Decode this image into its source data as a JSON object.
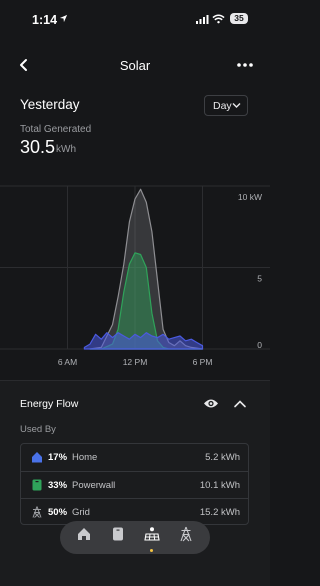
{
  "status_bar": {
    "time": "1:14",
    "battery": "35"
  },
  "nav": {
    "title": "Solar"
  },
  "period": {
    "title": "Yesterday",
    "selector_value": "Day"
  },
  "summary": {
    "label": "Total Generated",
    "value": "30.5",
    "unit": "kWh"
  },
  "chart_data": {
    "type": "area",
    "x_tick_labels": [
      "6 AM",
      "12 PM",
      "6 PM"
    ],
    "y_tick_labels": [
      "10 kW",
      "5",
      "0"
    ],
    "ylim": [
      0,
      10
    ],
    "xlim_hours": [
      0,
      24
    ],
    "grid": true,
    "series": [
      {
        "color": "#8e8e92",
        "x": [
          8.0,
          9.0,
          10.0,
          10.5,
          11.0,
          11.5,
          12.0,
          12.5,
          13.0,
          13.5,
          14.0,
          14.5,
          15.0,
          15.5,
          16.0,
          16.5,
          17.0,
          18.0
        ],
        "values": [
          0.0,
          0.1,
          1.5,
          3.2,
          5.2,
          7.8,
          9.2,
          9.8,
          9.0,
          7.2,
          4.2,
          1.2,
          0.4,
          0.2,
          0.5,
          0.2,
          0.1,
          0.0
        ]
      },
      {
        "color": "#2fa35a",
        "x": [
          8.0,
          9.0,
          10.0,
          10.5,
          11.0,
          11.5,
          12.0,
          12.5,
          13.0,
          13.5,
          14.0,
          14.5,
          15.0,
          15.5,
          16.0,
          18.0
        ],
        "values": [
          0.0,
          0.0,
          0.3,
          1.2,
          3.5,
          5.2,
          5.9,
          5.8,
          5.0,
          2.2,
          0.5,
          0.1,
          0.0,
          0.0,
          0.0,
          0.0
        ]
      },
      {
        "color": "#4a5ae0",
        "x": [
          7.5,
          8.0,
          8.5,
          9.0,
          9.5,
          10.0,
          10.5,
          11.0,
          11.5,
          12.0,
          12.5,
          13.0,
          13.5,
          14.0,
          14.5,
          15.0,
          15.5,
          16.0,
          16.5,
          17.0,
          17.5,
          18.0
        ],
        "values": [
          0.1,
          0.3,
          0.9,
          0.6,
          1.0,
          0.7,
          1.0,
          0.8,
          0.6,
          0.9,
          0.7,
          1.0,
          0.8,
          0.7,
          0.9,
          0.6,
          0.7,
          0.8,
          0.5,
          0.6,
          0.4,
          0.2
        ]
      }
    ]
  },
  "energy_flow": {
    "title": "Energy Flow",
    "used_by_label": "Used By",
    "rows": [
      {
        "icon": "home-icon",
        "color": "#4a72e8",
        "percent": "17%",
        "name": "Home",
        "value": "5.2 kWh"
      },
      {
        "icon": "powerwall-icon",
        "color": "#2fa35a",
        "percent": "33%",
        "name": "Powerwall",
        "value": "10.1 kWh"
      },
      {
        "icon": "grid-tower-icon",
        "color": "#9a9ca0",
        "percent": "50%",
        "name": "Grid",
        "value": "15.2 kWh"
      }
    ]
  },
  "tabbar": {
    "tabs": [
      "home-tab-icon",
      "powerwall-tab-icon",
      "solar-tab-icon",
      "grid-tab-icon"
    ],
    "active": "solar-tab-icon",
    "active_color": "#f5c542"
  }
}
